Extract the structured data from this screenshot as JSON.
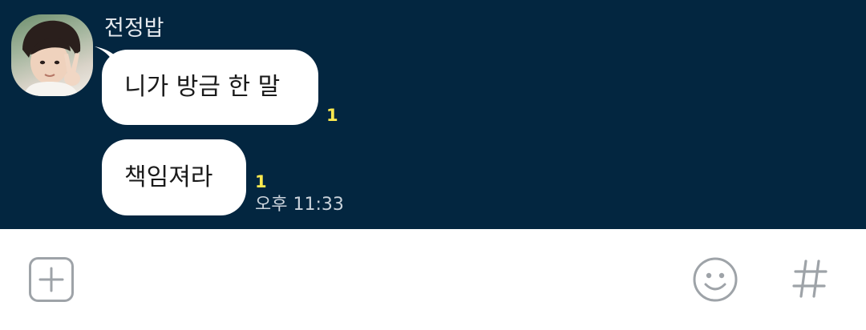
{
  "chat": {
    "sender_name": "전정밥",
    "messages": [
      {
        "text": "니가 방금 한 말",
        "unread": "1"
      },
      {
        "text": "책임져라",
        "unread": "1",
        "time": "오후 11:33"
      }
    ]
  },
  "input_bar": {
    "icons": {
      "attach": "plus-square-icon",
      "emoji": "smiley-icon",
      "hashtag": "hash-icon"
    }
  },
  "colors": {
    "chat_background": "#032640",
    "bubble": "#ffffff",
    "unread_count": "#fce94f",
    "icon_gray": "#9ea3a8"
  }
}
